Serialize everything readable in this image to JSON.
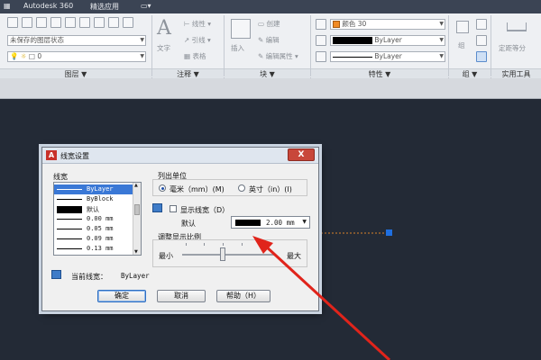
{
  "menubar": {
    "items": [
      "Autodesk 360",
      "精选应用"
    ]
  },
  "ribbon": {
    "layer_state": "未保存的图层状态",
    "layer_num": "0",
    "text_label": "文字",
    "linear_label": "线性",
    "leader_label": "引线",
    "table_label": "表格",
    "insert_label": "插入",
    "create_label": "创建",
    "edit_label": "编辑",
    "edit_attr_label": "编辑属性",
    "color_value": "颜色 30",
    "bylayer_1": "ByLayer",
    "bylayer_2": "ByLayer",
    "group_label": "组",
    "measure_label": "定距等分",
    "panels": {
      "layer": "图层 ▼",
      "annotation": "注释 ▼",
      "block": "块 ▼",
      "properties": "特性 ▼",
      "group": "组 ▼",
      "utilities": "实用工具"
    }
  },
  "dialog": {
    "title": "线宽设置",
    "close": "X",
    "lineweight_label": "线宽",
    "list_items": [
      {
        "label": "ByLayer",
        "thick": 1,
        "selected": true
      },
      {
        "label": "ByBlock",
        "thick": 1
      },
      {
        "label": "默认",
        "thick": 8
      },
      {
        "label": "0.00 mm",
        "thick": 1
      },
      {
        "label": "0.05 mm",
        "thick": 1
      },
      {
        "label": "0.09 mm",
        "thick": 1
      },
      {
        "label": "0.13 mm",
        "thick": 1
      }
    ],
    "units_label": "列出单位",
    "unit_mm": "毫米（mm）(M)",
    "unit_in": "英寸（in）(I)",
    "show_lineweight": "显示线宽（D）",
    "default_label": "默认",
    "default_value": "2.00 mm",
    "scale_label": "调整显示比例",
    "min_label": "最小",
    "max_label": "最大",
    "current_label": "当前线宽：",
    "current_value": "ByLayer",
    "ok": "确定",
    "cancel": "取消",
    "help": "帮助（H）"
  },
  "colors": {
    "canvas": "#232a36",
    "arrow": "#e0241b",
    "grip": "#1f6fe0",
    "line": "#d9822b"
  }
}
